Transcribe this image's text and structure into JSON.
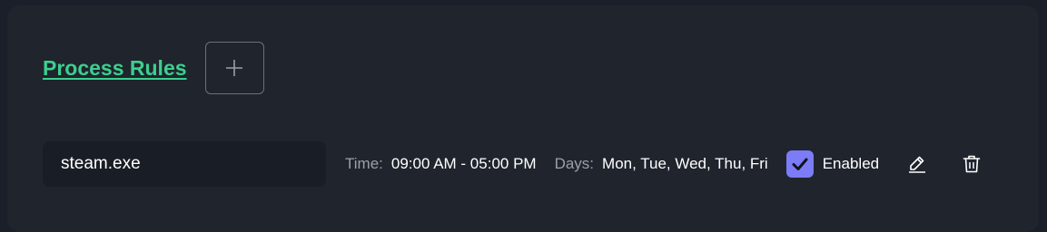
{
  "header": {
    "title": "Process Rules",
    "add_icon": "plus-icon"
  },
  "rules": [
    {
      "process": "steam.exe",
      "time_label": "Time:",
      "time_value": "09:00 AM - 05:00 PM",
      "days_label": "Days:",
      "days_value": "Mon, Tue, Wed, Thu, Fri",
      "enabled": true,
      "enabled_label": "Enabled",
      "edit_icon": "pencil-icon",
      "delete_icon": "trash-icon"
    }
  ],
  "colors": {
    "accent_green": "#3ccf8e",
    "checkbox_purple": "#7c7cf8",
    "panel_bg": "#1f242d",
    "input_bg": "#191d25"
  }
}
